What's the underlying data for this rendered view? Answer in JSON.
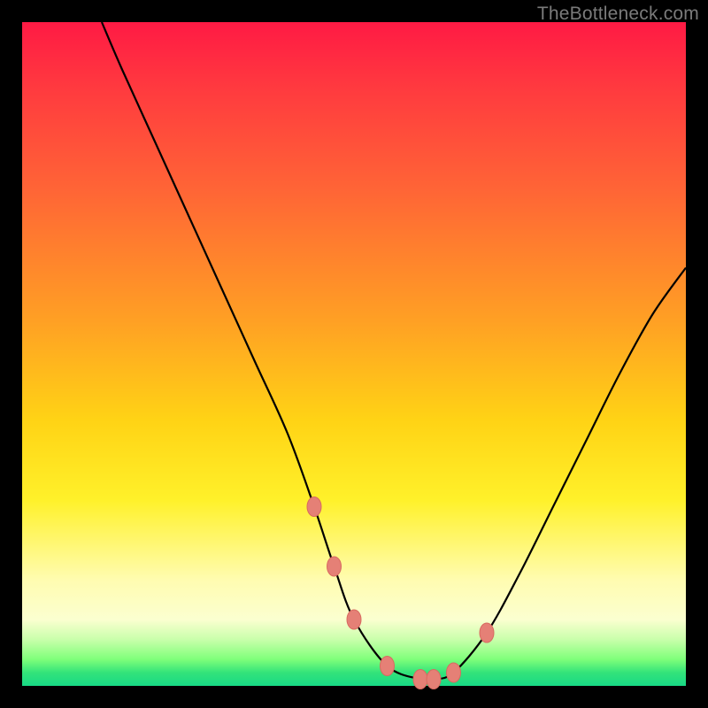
{
  "watermark": "TheBottleneck.com",
  "chart_data": {
    "type": "line",
    "title": "",
    "xlabel": "",
    "ylabel": "",
    "xlim": [
      0,
      100
    ],
    "ylim": [
      0,
      100
    ],
    "grid": false,
    "legend": false,
    "series": [
      {
        "name": "bottleneck-curve",
        "x": [
          12,
          15,
          20,
          25,
          30,
          35,
          40,
          44,
          47,
          50,
          55,
          60,
          62,
          65,
          70,
          75,
          80,
          85,
          90,
          95,
          100
        ],
        "values": [
          100,
          93,
          82,
          71,
          60,
          49,
          38,
          27,
          18,
          10,
          3,
          1,
          1,
          2,
          8,
          17,
          27,
          37,
          47,
          56,
          63
        ]
      }
    ],
    "markers": {
      "name": "highlight-points",
      "x": [
        44,
        47,
        50,
        55,
        60,
        62,
        65,
        70
      ],
      "values": [
        27,
        18,
        10,
        3,
        1,
        1,
        2,
        8
      ]
    },
    "background_gradient": {
      "top": "#ff1a44",
      "mid": "#ffd315",
      "bottom": "#18d985"
    }
  }
}
